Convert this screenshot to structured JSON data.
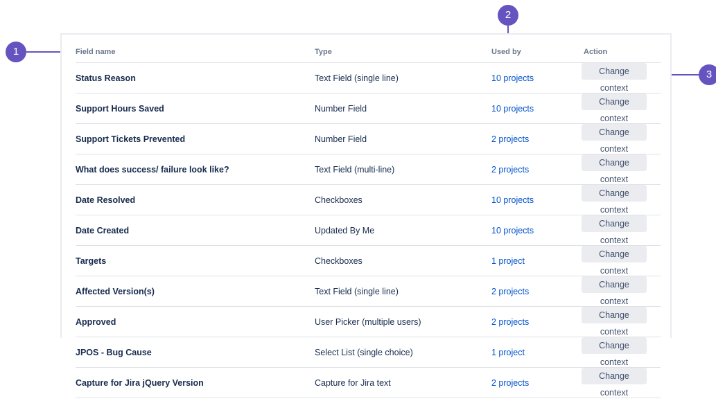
{
  "callouts": [
    "1",
    "2",
    "3"
  ],
  "columns": {
    "field_name": "Field name",
    "type": "Type",
    "used_by": "Used by",
    "action": "Action"
  },
  "rows": [
    {
      "name": "Status Reason",
      "type": "Text Field (single line)",
      "used_by": "10 projects",
      "action": "Change context"
    },
    {
      "name": "Support Hours Saved",
      "type": "Number Field",
      "used_by": "10 projects",
      "action": "Change context"
    },
    {
      "name": "Support Tickets Prevented",
      "type": "Number Field",
      "used_by": "2 projects",
      "action": "Change context"
    },
    {
      "name": "What does success/ failure look like?",
      "type": "Text Field (multi-line)",
      "used_by": "2 projects",
      "action": "Change context"
    },
    {
      "name": "Date Resolved",
      "type": "Checkboxes",
      "used_by": "10 projects",
      "action": "Change context"
    },
    {
      "name": "Date Created",
      "type": "Updated By Me",
      "used_by": "10 projects",
      "action": "Change context"
    },
    {
      "name": "Targets",
      "type": "Checkboxes",
      "used_by": "1 project",
      "action": "Change context"
    },
    {
      "name": "Affected Version(s)",
      "type": "Text Field (single line)",
      "used_by": "2 projects",
      "action": "Change context"
    },
    {
      "name": "Approved",
      "type": "User Picker (multiple users)",
      "used_by": "2 projects",
      "action": "Change context"
    },
    {
      "name": "JPOS - Bug Cause",
      "type": "Select List (single choice)",
      "used_by": "1 project",
      "action": "Change context"
    },
    {
      "name": "Capture for Jira jQuery Version",
      "type": "Capture for Jira text",
      "used_by": "2 projects",
      "action": "Change context"
    }
  ],
  "colors": {
    "accent": "#6554C0",
    "link": "#0052CC",
    "button_bg": "#EBECF0"
  }
}
